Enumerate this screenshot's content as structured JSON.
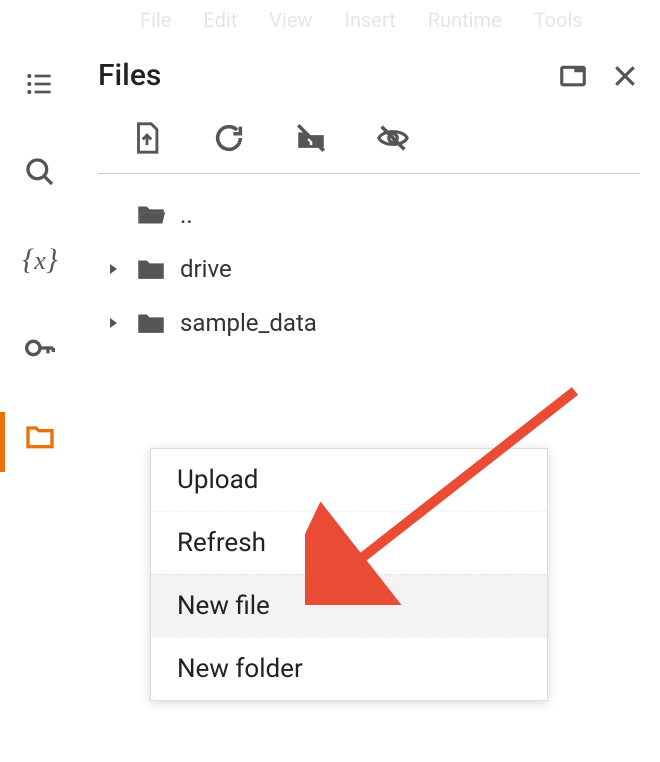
{
  "menubar": {
    "items": [
      "File",
      "Edit",
      "View",
      "Insert",
      "Runtime",
      "Tools"
    ]
  },
  "panel": {
    "title": "Files"
  },
  "tree": {
    "parent": "..",
    "items": [
      {
        "name": "drive"
      },
      {
        "name": "sample_data"
      }
    ]
  },
  "context_menu": {
    "items": [
      {
        "label": "Upload"
      },
      {
        "label": "Refresh"
      },
      {
        "label": "New file",
        "highlight": true
      },
      {
        "label": "New folder"
      }
    ]
  },
  "colors": {
    "accent": "#e8710a",
    "arrow": "#eb4a34"
  }
}
